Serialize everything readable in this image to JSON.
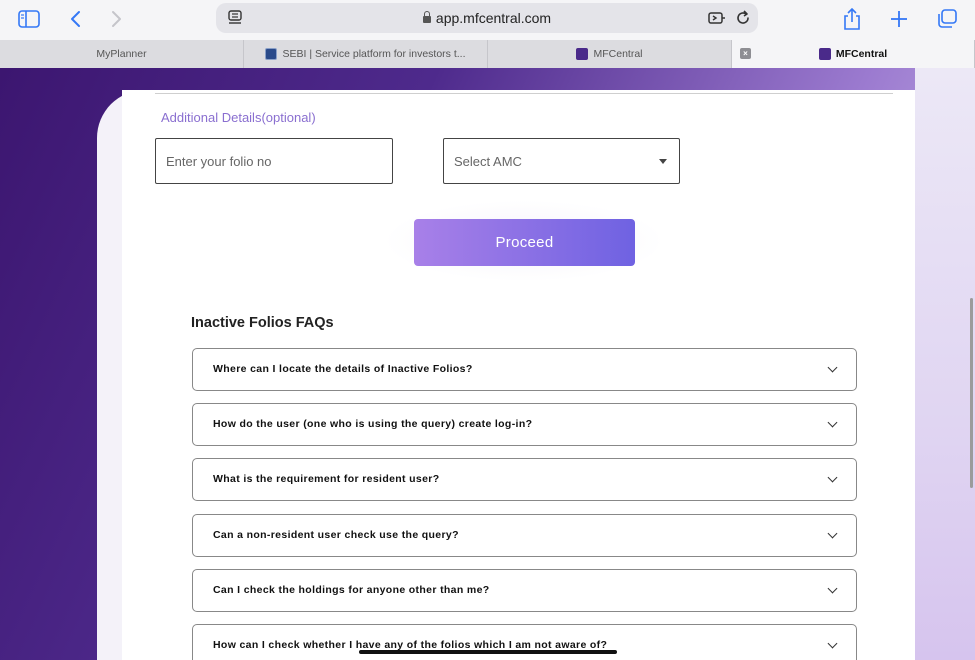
{
  "browser": {
    "url": "app.mfcentral.com",
    "tabs": [
      {
        "label": "MyPlanner"
      },
      {
        "label": "SEBI | Service platform for investors t..."
      },
      {
        "label": "MFCentral"
      },
      {
        "label": ""
      },
      {
        "label": "MFCentral"
      }
    ]
  },
  "form": {
    "section_label": "Additional Details(optional)",
    "folio_placeholder": "Enter your folio no",
    "amc_placeholder": "Select AMC",
    "proceed_label": "Proceed"
  },
  "faq": {
    "title": "Inactive Folios FAQs",
    "items": [
      {
        "question": "Where can I locate the details of Inactive Folios?"
      },
      {
        "question": "How do the user (one who is using the query) create log-in?"
      },
      {
        "question": "What is the requirement for resident user?"
      },
      {
        "question": "Can a non-resident user check use the query?"
      },
      {
        "question": "Can I check the holdings for anyone other than me?"
      },
      {
        "question": "How can I check whether I have any of the folios which I am not aware of?"
      }
    ]
  }
}
